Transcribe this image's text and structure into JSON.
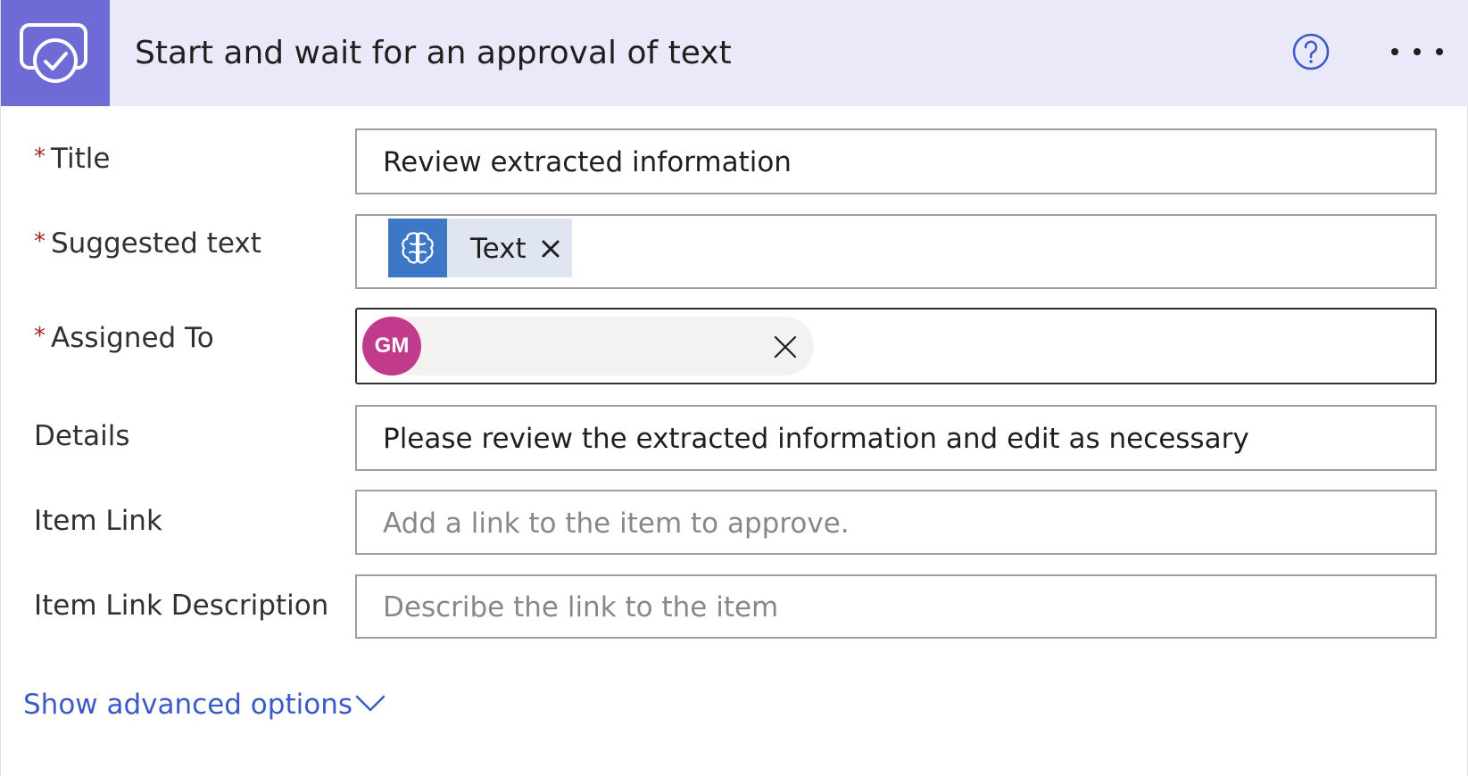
{
  "header": {
    "title": "Start and wait for an approval of text",
    "icon": "approval-icon",
    "help_icon": "help-icon",
    "more_icon": "more-icon",
    "accent_color": "#6e6bd6",
    "background_color": "#e9e9f9"
  },
  "form": {
    "required_mark": "*",
    "title": {
      "label": "Title",
      "value": "Review extracted information"
    },
    "suggested_text": {
      "label": "Suggested text",
      "token_label": "Text",
      "token_icon": "ai-brain-icon",
      "token_color": "#3d78c6"
    },
    "assigned_to": {
      "label": "Assigned To",
      "avatar_initials": "GM",
      "avatar_color": "#c23a8c"
    },
    "details": {
      "label": "Details",
      "value": "Please review the extracted information and edit as necessary"
    },
    "item_link": {
      "label": "Item Link",
      "placeholder": "Add a link to the item to approve."
    },
    "item_link_description": {
      "label": "Item Link Description",
      "placeholder": "Describe the link to the item"
    }
  },
  "advanced": {
    "label": "Show advanced options",
    "link_color": "#3b5ac8"
  }
}
